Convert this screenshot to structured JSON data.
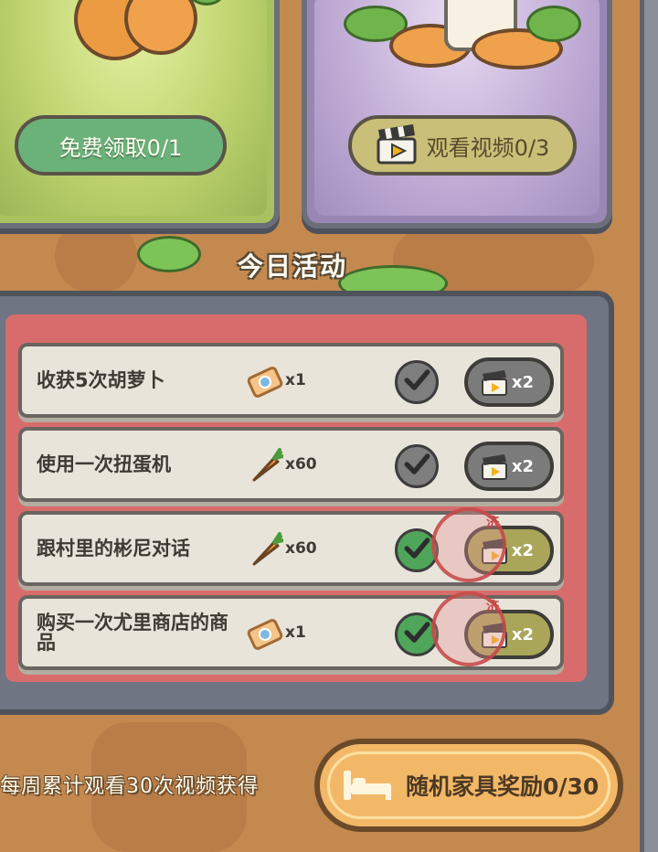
{
  "top_cards": {
    "free_claim_label": "免费领取0/1",
    "watch_video_label": "观看视频0/3"
  },
  "section_title": "今日活动",
  "tasks": [
    {
      "label": "收获5次胡萝卜",
      "reward_icon": "ticket-icon",
      "reward_qty": "x1",
      "check_state": "gray",
      "multiplier": "x2",
      "stamped": false
    },
    {
      "label": "使用一次扭蛋机",
      "reward_icon": "carrot-icon",
      "reward_qty": "x60",
      "check_state": "gray",
      "multiplier": "x2",
      "stamped": false
    },
    {
      "label": "跟村里的彬尼对话",
      "reward_icon": "carrot-icon",
      "reward_qty": "x60",
      "check_state": "green",
      "multiplier": "x2",
      "stamped": true,
      "stamp_char": "济"
    },
    {
      "label": "购买一次尤里商店的商品",
      "reward_icon": "ticket-icon",
      "reward_qty": "x1",
      "check_state": "green",
      "multiplier": "x2",
      "stamped": true,
      "stamp_char": "济"
    }
  ],
  "weekly": {
    "description": "每周累计观看30次视频获得",
    "reward_label": "随机家具奖励0/30"
  },
  "colors": {
    "background": "#c4894f",
    "task_board": "#d86c6c",
    "free_button": "#6bb17a",
    "video_button": "#c9bf78",
    "reward_button": "#f3b867"
  }
}
